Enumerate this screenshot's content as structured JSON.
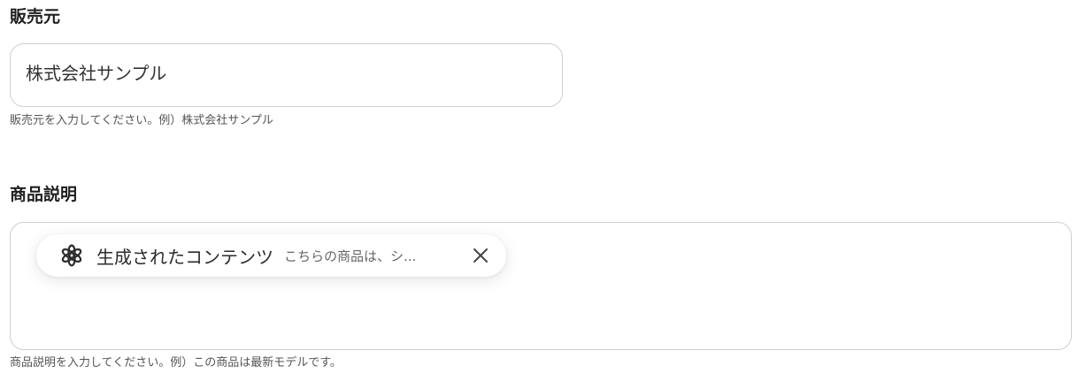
{
  "vendor": {
    "label": "販売元",
    "value": "株式会社サンプル",
    "help": "販売元を入力してください。例）株式会社サンプル"
  },
  "description": {
    "label": "商品説明",
    "chip": {
      "icon": "openai-logo-icon",
      "title": "生成されたコンテンツ",
      "preview": "こちらの商品は、シ...",
      "close_icon": "close-icon"
    },
    "help": "商品説明を入力してください。例）この商品は最新モデルです。"
  }
}
